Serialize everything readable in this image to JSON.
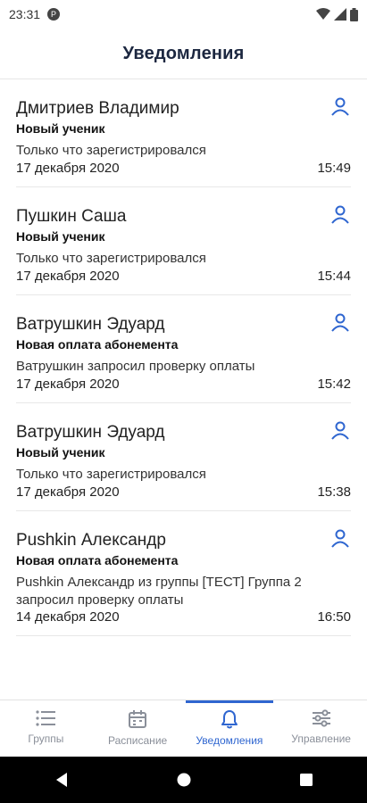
{
  "status_bar": {
    "time": "23:31",
    "app_badge": "P"
  },
  "header": {
    "title": "Уведомления"
  },
  "notifications": [
    {
      "name": "Дмитриев Владимир",
      "type": "Новый ученик",
      "description": "Только что зарегистрировался",
      "date": "17 декабря 2020",
      "time": "15:49"
    },
    {
      "name": "Пушкин Саша",
      "type": "Новый ученик",
      "description": "Только что зарегистрировался",
      "date": "17 декабря 2020",
      "time": "15:44"
    },
    {
      "name": "Ватрушкин Эдуард",
      "type": "Новая оплата абонемента",
      "description": "Ватрушкин запросил проверку оплаты",
      "date": "17 декабря 2020",
      "time": "15:42"
    },
    {
      "name": "Ватрушкин Эдуард",
      "type": "Новый ученик",
      "description": "Только что зарегистрировался",
      "date": "17 декабря 2020",
      "time": "15:38"
    },
    {
      "name": "Pushkin Александр",
      "type": "Новая оплата абонемента",
      "description": "Pushkin Александр из группы [ТЕСТ] Группа 2 запросил проверку оплаты",
      "date": "14 декабря 2020",
      "time": "16:50"
    }
  ],
  "bottom_nav": {
    "groups": "Группы",
    "schedule": "Расписание",
    "notifications": "Уведомления",
    "management": "Управление"
  },
  "colors": {
    "accent": "#2f66d0",
    "inactive": "#8a8f99",
    "title": "#1c2740"
  }
}
